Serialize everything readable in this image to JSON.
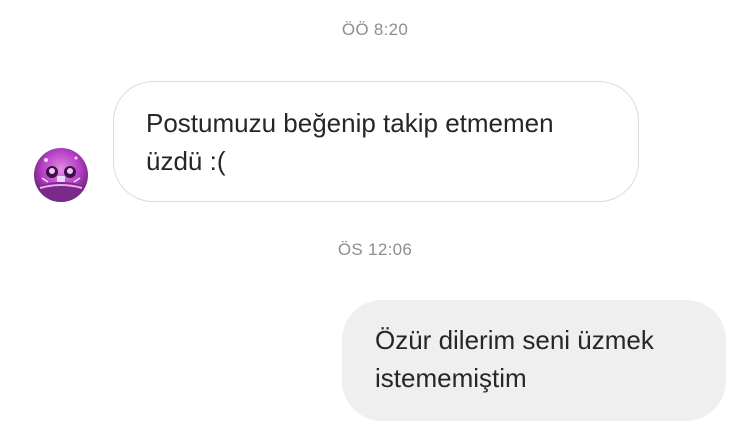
{
  "thread": {
    "messages": [
      {
        "timestamp": "ÖÖ 8:20",
        "direction": "incoming",
        "text": "Postumuzu beğenip takip etmemen üzdü :("
      },
      {
        "timestamp": "ÖS 12:06",
        "direction": "outgoing",
        "text": "Özür dilerim seni üzmek istememiştim"
      }
    ]
  },
  "colors": {
    "timestamp": "#8e8e8e",
    "incoming_border": "#dbdbdb",
    "outgoing_bubble": "#efefef",
    "text": "#262626",
    "avatar_accent": "#b63fc4"
  },
  "icons": {
    "avatar": "contact-avatar-image"
  }
}
